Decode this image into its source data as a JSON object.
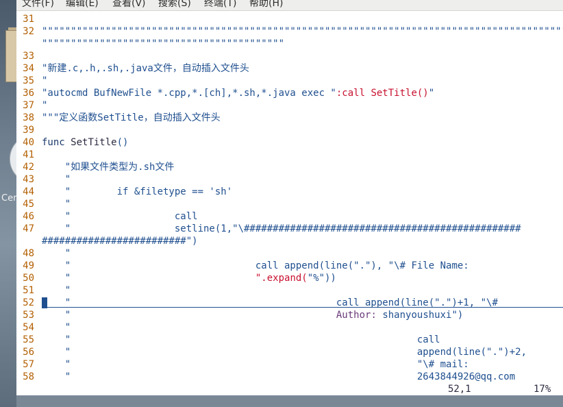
{
  "menubar": {
    "items": [
      "文件(F)",
      "编辑(E)",
      "查看(V)",
      "搜索(S)",
      "终端(T)",
      "帮助(H)"
    ]
  },
  "desktop": {
    "icon_label": "Cen"
  },
  "editor": {
    "lines": [
      {
        "num": "31",
        "segments": [
          {
            "text": ""
          }
        ]
      },
      {
        "num": "32",
        "segments": [
          {
            "text": "\"\"\"\"\"\"\"\"\"\"\"\"\"\"\"\"\"\"\"\"\"\"\"\"\"\"\"\"\"\"\"\"\"\"\"\"\"\"\"\"\"\"\"\"\"\"\"\"\"\"\"\"\"\"\"\"\"\"\"\"\"\"\"\"\"\"\"\"\"\"\"\"\"\"\"\"\"\"\"\"\"\"\"\"\"\"\"\"\"\"\"\"\"\"\"\"\"\"\"\"\"\"\"\"\"\"\"\"\"\"\"\"\"\"\"\"\"\"\"\"\"\"\"\"\"\"\"\"\"\"\"\"\"\"\"\"\"\"\"\"\"\"\"\"\"\"\"\"\"\"\"\"\"\"\"\"\"\"\"\"\"\"\"\"\"\"\"\"\"\"\"\"\"\"\"\"\"\"\"\"\"\"\"\"\"\"\"\"\""
          }
        ]
      },
      {
        "num": "",
        "segments": [
          {
            "text": "\"\"\"\"\"\"\"\"\"\"\"\"\"\"\"\"\"\"\"\"\"\"\"\"\"\"\"\"\"\"\"\"\"\"\"\"\"\"\"\"\"\""
          }
        ]
      },
      {
        "num": "33",
        "segments": [
          {
            "text": ""
          }
        ]
      },
      {
        "num": "34",
        "segments": [
          {
            "text": "\"新建.c,.h,.sh,.java文件，自动插入文件头"
          }
        ]
      },
      {
        "num": "35",
        "segments": [
          {
            "text": "\""
          }
        ]
      },
      {
        "num": "36",
        "segments": [
          {
            "text": "\"autocmd BufNewFile *.cpp,*.[ch],*.sh,*.java exec \""
          },
          {
            "text": ":call SetTitle()",
            "cls": "red"
          },
          {
            "text": "\""
          }
        ]
      },
      {
        "num": "37",
        "segments": [
          {
            "text": "\""
          }
        ]
      },
      {
        "num": "38",
        "segments": [
          {
            "text": "\"\"\"定义函数SetTitle，自动插入文件头"
          }
        ]
      },
      {
        "num": "39",
        "segments": [
          {
            "text": ""
          }
        ]
      },
      {
        "num": "40",
        "segments": [
          {
            "text": "func ",
            "cls": "kw"
          },
          {
            "text": "SetTitle",
            "cls": "dark"
          },
          {
            "text": "()"
          }
        ]
      },
      {
        "num": "41",
        "segments": [
          {
            "text": ""
          }
        ]
      },
      {
        "num": "42",
        "segments": [
          {
            "text": "    \"如果文件类型为.sh文件"
          }
        ]
      },
      {
        "num": "43",
        "segments": [
          {
            "text": "    \""
          }
        ]
      },
      {
        "num": "44",
        "segments": [
          {
            "text": "    \"        if &filetype == 'sh'"
          }
        ]
      },
      {
        "num": "45",
        "segments": [
          {
            "text": "    \""
          }
        ]
      },
      {
        "num": "46",
        "segments": [
          {
            "text": "    \"                  call"
          }
        ]
      },
      {
        "num": "47",
        "segments": [
          {
            "text": "    \"                  setline(1,\"\\################################################"
          }
        ]
      },
      {
        "num": "",
        "segments": [
          {
            "text": "#########################\")"
          }
        ]
      },
      {
        "num": "48",
        "segments": [
          {
            "text": "    \""
          }
        ]
      },
      {
        "num": "49",
        "segments": [
          {
            "text": "    \"                                call append(line(\".\"), \"\\# File Name:"
          }
        ]
      },
      {
        "num": "50",
        "segments": [
          {
            "text": "    \"                                "
          },
          {
            "text": "\".expand(",
            "cls": "red"
          },
          {
            "text": "\"%\"))"
          }
        ]
      },
      {
        "num": "51",
        "segments": [
          {
            "text": "    \""
          }
        ]
      },
      {
        "num": "52",
        "segments": [
          {
            "text": "    \"                                              call append(line(\".\")+1, \"\\#"
          }
        ]
      },
      {
        "num": "53",
        "segments": [
          {
            "text": "    \"                                              "
          },
          {
            "text": "Author:",
            "cls": "purple"
          },
          {
            "text": " shanyoushuxi\")"
          }
        ]
      },
      {
        "num": "54",
        "segments": [
          {
            "text": "    \""
          }
        ]
      },
      {
        "num": "55",
        "segments": [
          {
            "text": "    \"                                                            call"
          }
        ]
      },
      {
        "num": "56",
        "segments": [
          {
            "text": "    \"                                                            append(line(\".\")+2,"
          }
        ]
      },
      {
        "num": "57",
        "segments": [
          {
            "text": "    \"                                                            \"\\# mail:"
          }
        ]
      },
      {
        "num": "58",
        "segments": [
          {
            "text": "    \"                                                            2643844926@qq.com"
          }
        ]
      }
    ]
  },
  "statusbar": {
    "position": "52,1",
    "percent": "17%"
  },
  "colors": {
    "text": "#1f4f8f",
    "line_numbers": "#b35f00",
    "special": "#c8102e"
  }
}
